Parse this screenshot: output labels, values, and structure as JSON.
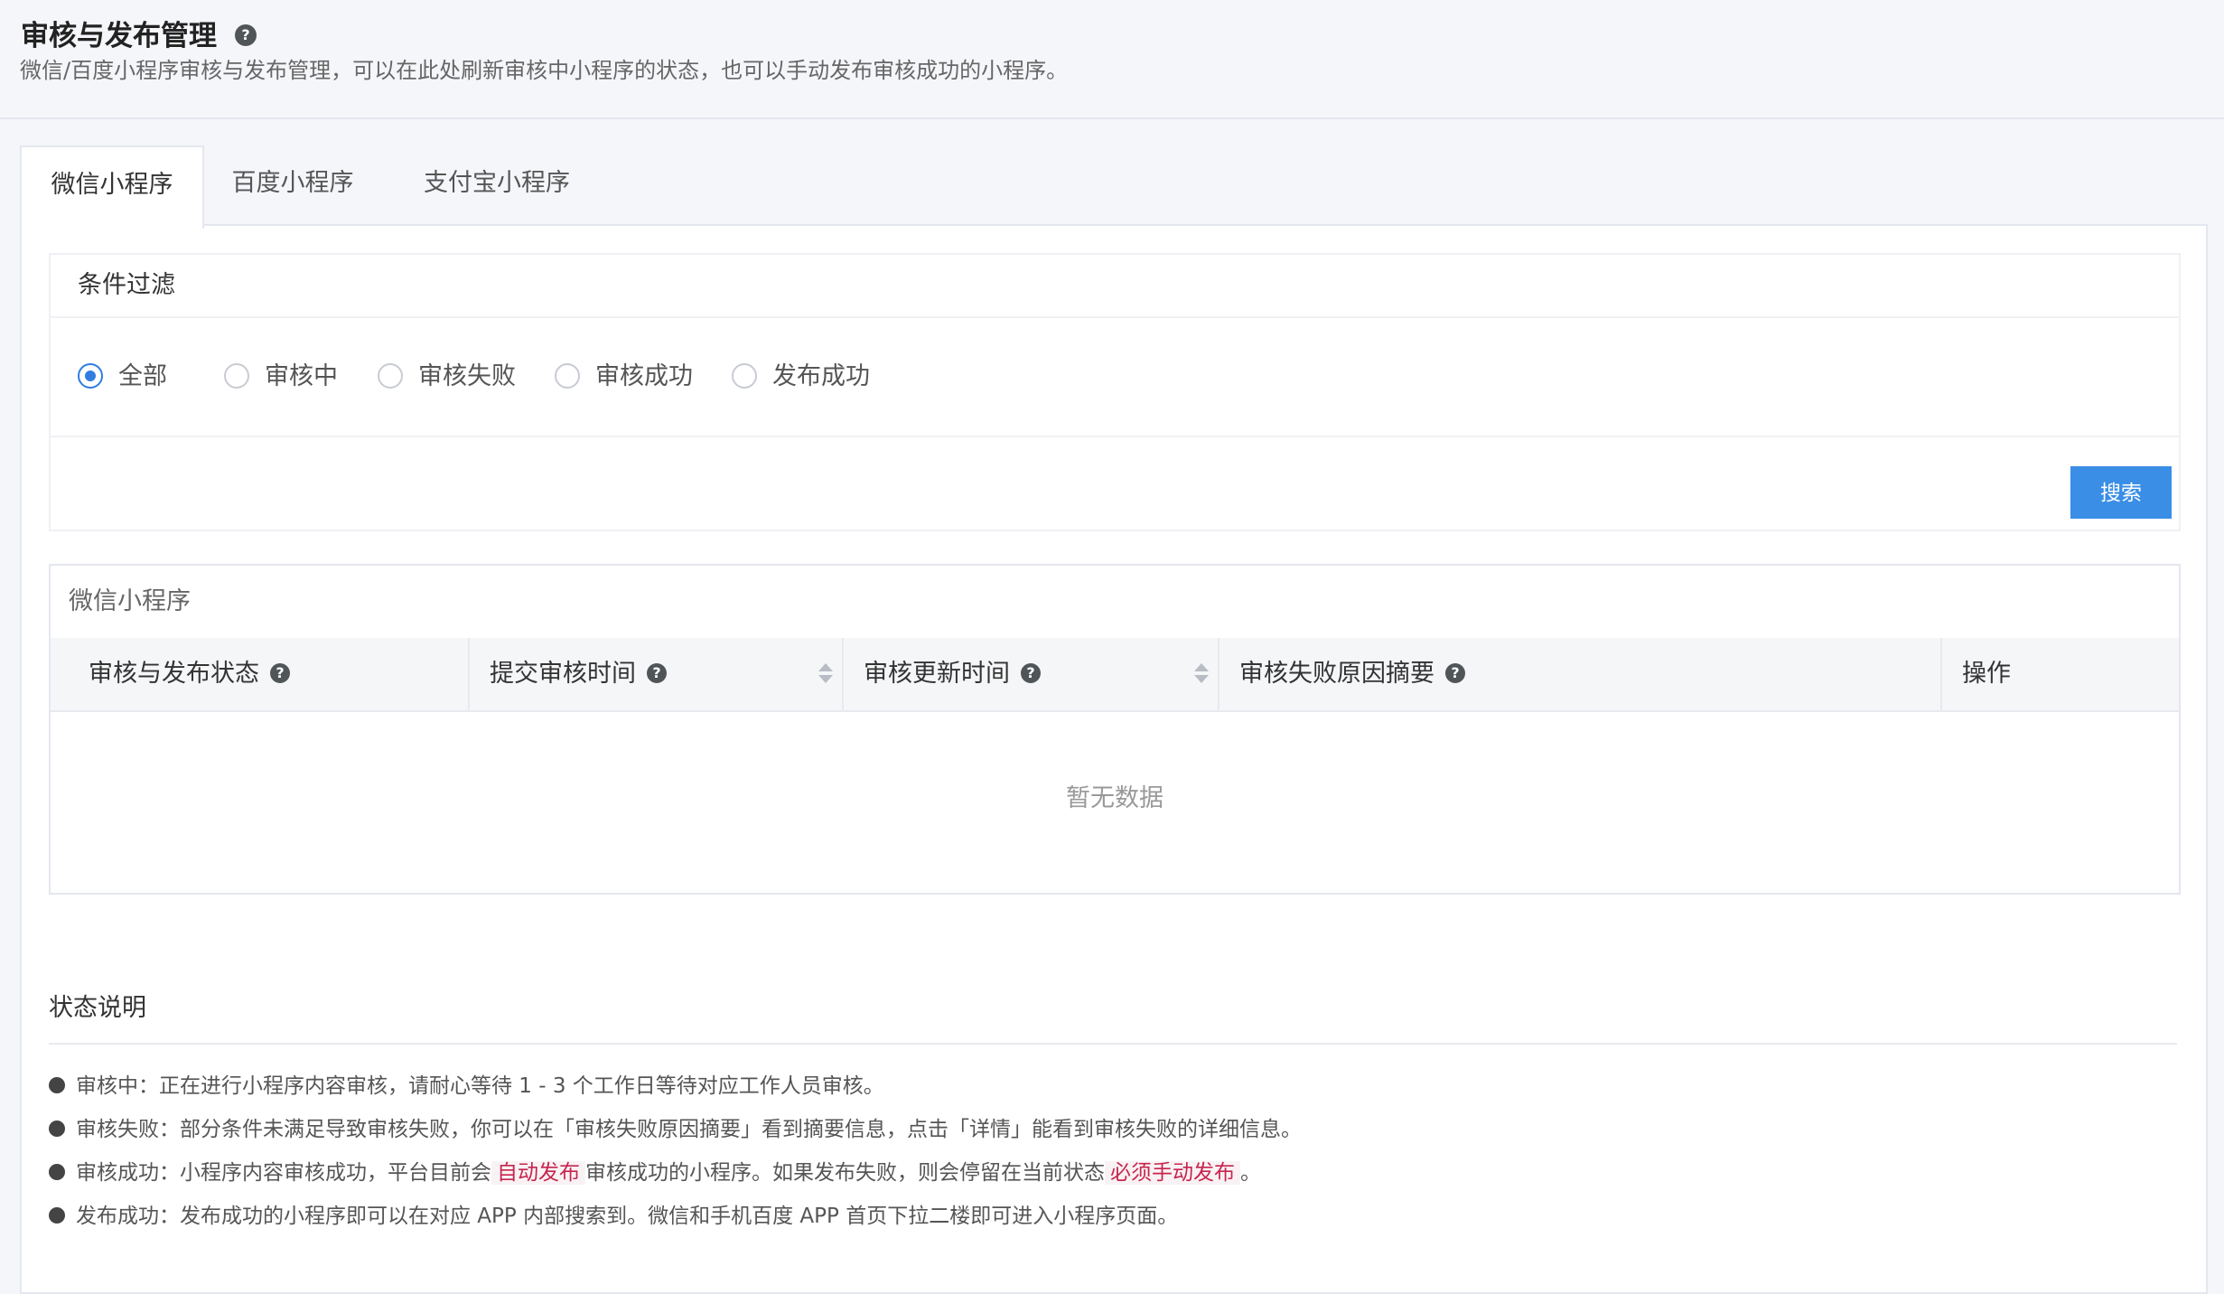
{
  "header": {
    "title": "审核与发布管理",
    "help_icon": "question-circle-icon",
    "description": "微信/百度小程序审核与发布管理，可以在此处刷新审核中小程序的状态，也可以手动发布审核成功的小程序。"
  },
  "tabs": [
    {
      "label": "微信小程序",
      "active": true
    },
    {
      "label": "百度小程序",
      "active": false
    },
    {
      "label": "支付宝小程序",
      "active": false
    }
  ],
  "filter": {
    "title": "条件过滤",
    "options": [
      "全部",
      "审核中",
      "审核失败",
      "审核成功",
      "发布成功"
    ],
    "selected": "全部",
    "search_label": "搜索"
  },
  "table": {
    "caption": "微信小程序",
    "columns": [
      {
        "label": "审核与发布状态",
        "help": true,
        "sortable": false
      },
      {
        "label": "提交审核时间",
        "help": true,
        "sortable": true
      },
      {
        "label": "审核更新时间",
        "help": true,
        "sortable": true
      },
      {
        "label": "审核失败原因摘要",
        "help": true,
        "sortable": false
      },
      {
        "label": "操作",
        "help": false,
        "sortable": false
      }
    ],
    "empty_text": "暂无数据"
  },
  "status": {
    "title": "状态说明",
    "lines": [
      {
        "text": "审核中：正在进行小程序内容审核，请耐心等待 1 - 3 个工作日等待对应工作人员审核。"
      },
      {
        "text": "审核失败：部分条件未满足导致审核失败，你可以在「审核失败原因摘要」看到摘要信息，点击「详情」能看到审核失败的详细信息。"
      },
      {
        "prefix": "审核成功：小程序内容审核成功，平台目前会",
        "tag1": "自动发布",
        "middle": "审核成功的小程序。如果发布失败，则会停留在当前状态",
        "tag2": "必须手动发布",
        "suffix": "。"
      },
      {
        "text": "发布成功：发布成功的小程序即可以在对应 APP 内部搜索到。微信和手机百度 APP 首页下拉二楼即可进入小程序页面。"
      }
    ]
  },
  "colors": {
    "accent": "#3a8ee6",
    "tag_text": "#c7254e",
    "tag_bg": "#f9f2f4",
    "background": "#f5f6fa"
  }
}
